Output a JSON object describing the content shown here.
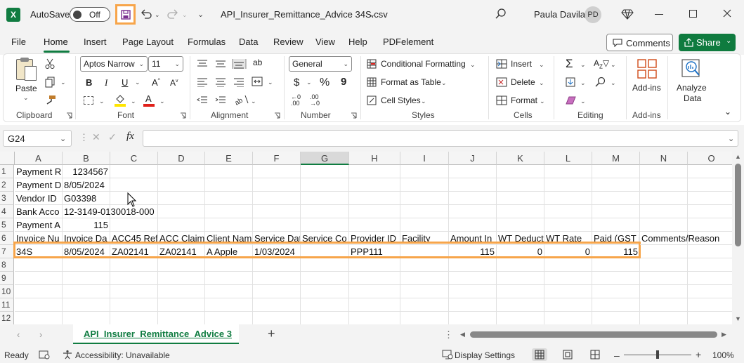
{
  "titlebar": {
    "app_icon": "excel-icon",
    "autosave_label": "AutoSave",
    "autosave_state": "Off",
    "file_name": "API_Insurer_Remittance_Advice 34S.csv",
    "user_name": "Paula Davila",
    "user_initials": "PD"
  },
  "tabs": [
    "File",
    "Home",
    "Insert",
    "Page Layout",
    "Formulas",
    "Data",
    "Review",
    "View",
    "Help",
    "PDFelement"
  ],
  "tab_buttons": {
    "comments": "Comments",
    "share": "Share"
  },
  "ribbon": {
    "clipboard": {
      "label": "Clipboard",
      "paste": "Paste"
    },
    "font": {
      "label": "Font",
      "family": "Aptos Narrow",
      "size": "11",
      "bold": "B",
      "italic": "I",
      "underline": "U"
    },
    "alignment": {
      "label": "Alignment"
    },
    "number": {
      "label": "Number",
      "format": "General",
      "currency": "$",
      "percent": "%",
      "comma": "9"
    },
    "styles": {
      "label": "Styles",
      "conditional": "Conditional Formatting",
      "table": "Format as Table",
      "cell_styles": "Cell Styles"
    },
    "cells": {
      "label": "Cells",
      "insert": "Insert",
      "delete": "Delete",
      "format": "Format"
    },
    "editing": {
      "label": "Editing"
    },
    "addins": {
      "label": "Add-ins",
      "addins_btn": "Add-ins",
      "analyze": "Analyze",
      "analyze2": "Data"
    }
  },
  "formula_bar": {
    "name_box": "G24",
    "fx": "fx",
    "value": ""
  },
  "columns": [
    "A",
    "B",
    "C",
    "D",
    "E",
    "F",
    "G",
    "H",
    "I",
    "J",
    "K",
    "L",
    "M",
    "N",
    "O"
  ],
  "rows": [
    "1",
    "2",
    "3",
    "4",
    "5",
    "6",
    "7",
    "8",
    "9",
    "10",
    "11",
    "12"
  ],
  "cells": {
    "A1": "Payment R",
    "B1": "1234567",
    "A2": "Payment D",
    "B2": "8/05/2024",
    "A3": "Vendor ID",
    "B3": "G03398",
    "A4": "Bank Acco",
    "B4": "12-3149-0130018-000",
    "A5": "Payment A",
    "B5": "115",
    "A6": "Invoice Nu",
    "B6": "Invoice Da",
    "C6": "ACC45 Ref",
    "D6": "ACC Claim",
    "E6": "Client Nam",
    "F6": "Service Dat",
    "G6": "Service Co",
    "H6": "Provider ID",
    "I6": "Facility",
    "J6": "Amount In",
    "K6": "WT Deduct",
    "L6": "WT Rate",
    "M6": "Paid (GST i",
    "N6": "Comments/Reason",
    "A7": "34S",
    "B7": "8/05/2024",
    "C7": "ZA02141",
    "D7": "ZA02141",
    "E7": "A Apple",
    "F7": "1/03/2024",
    "H7": "PPP111",
    "J7": "115",
    "K7": "0",
    "L7": "0",
    "M7": "115"
  },
  "sheet_tab": "API_Insurer_Remittance_Advice 3",
  "status": {
    "ready": "Ready",
    "accessibility": "Accessibility: Unavailable",
    "display": "Display Settings",
    "zoom": "100%"
  },
  "colors": {
    "highlight": "#f7a54a",
    "excel_green": "#107c41",
    "share_green": "#0f7b3f"
  }
}
